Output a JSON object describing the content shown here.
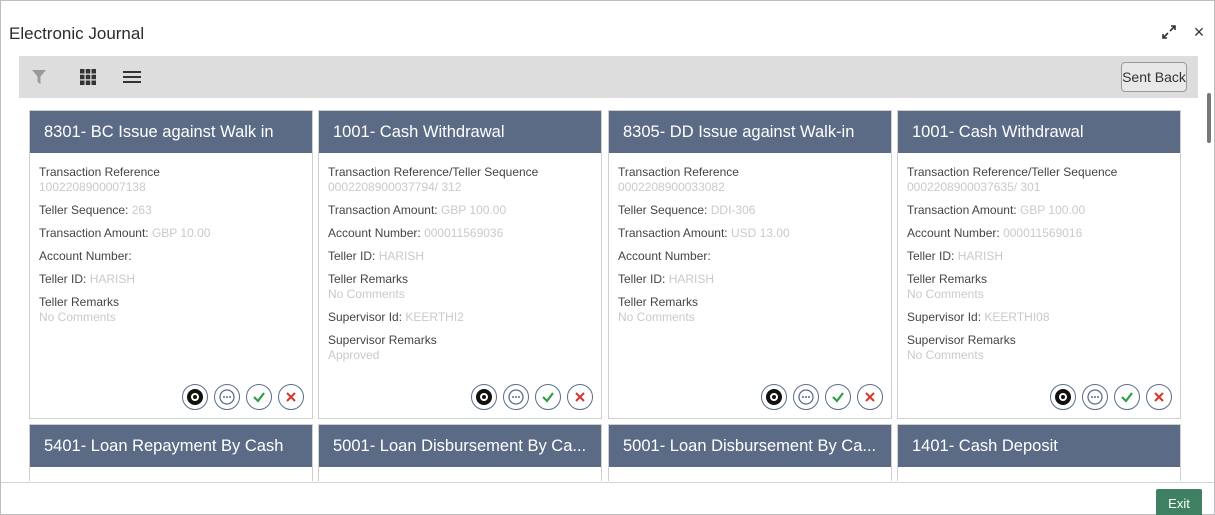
{
  "window": {
    "title": "Electronic Journal",
    "close_symbol": "×"
  },
  "toolbar": {
    "sent_back_label": "Sent Back",
    "icons": [
      "filter-icon",
      "grid-view-icon",
      "list-view-icon"
    ]
  },
  "colors": {
    "card_header": "#5c6b85",
    "toolbar_bg": "#dddddd",
    "exit_button": "#3f7f62",
    "approve_green": "#2e9e44",
    "reject_red": "#d9352e",
    "action_blue": "#5a6e8a"
  },
  "cards": [
    {
      "title": "8301- BC Issue against Walk in",
      "ref_label": "Transaction Reference",
      "ref_value": "1002208900007138",
      "teller_seq_label": "Teller Sequence:",
      "teller_seq_value": "263",
      "amount_label": "Transaction Amount:",
      "amount_value": "GBP 10.00",
      "account_label": "Account Number:",
      "account_value": "",
      "teller_id_label": "Teller ID:",
      "teller_id_value": "HARISH",
      "remarks_label": "Teller Remarks",
      "remarks_value": "No Comments"
    },
    {
      "title": "1001- Cash Withdrawal",
      "ref_label": "Transaction Reference/Teller Sequence",
      "ref_value": "0002208900037794/ 312",
      "amount_label": "Transaction Amount:",
      "amount_value": "GBP 100.00",
      "account_label": "Account Number:",
      "account_value": "000011569036",
      "teller_id_label": "Teller ID:",
      "teller_id_value": "HARISH",
      "remarks_label": "Teller Remarks",
      "remarks_value": "No Comments",
      "supervisor_id_label": "Supervisor Id:",
      "supervisor_id_value": "KEERTHI2",
      "supervisor_remarks_label": "Supervisor Remarks",
      "supervisor_remarks_value": "Approved"
    },
    {
      "title": "8305- DD Issue against Walk-in",
      "ref_label": "Transaction Reference",
      "ref_value": "0002208900033082",
      "teller_seq_label": "Teller Sequence:",
      "teller_seq_value": "DDI-306",
      "amount_label": "Transaction Amount:",
      "amount_value": "USD 13.00",
      "account_label": "Account Number:",
      "account_value": "",
      "teller_id_label": "Teller ID:",
      "teller_id_value": "HARISH",
      "remarks_label": "Teller Remarks",
      "remarks_value": "No Comments"
    },
    {
      "title": "1001- Cash Withdrawal",
      "ref_label": "Transaction Reference/Teller Sequence",
      "ref_value": "0002208900037635/ 301",
      "amount_label": "Transaction Amount:",
      "amount_value": "GBP 100.00",
      "account_label": "Account Number:",
      "account_value": "000011569016",
      "teller_id_label": "Teller ID:",
      "teller_id_value": "HARISH",
      "remarks_label": "Teller Remarks",
      "remarks_value": "No Comments",
      "supervisor_id_label": "Supervisor Id:",
      "supervisor_id_value": "KEERTHI08",
      "supervisor_remarks_label": "Supervisor Remarks",
      "supervisor_remarks_value": "No Comments"
    },
    {
      "title": "5401- Loan Repayment By Cash"
    },
    {
      "title": "5001- Loan Disbursement By Ca..."
    },
    {
      "title": "5001- Loan Disbursement By Ca..."
    },
    {
      "title": "1401- Cash Deposit"
    }
  ],
  "footer": {
    "exit_label": "Exit"
  }
}
